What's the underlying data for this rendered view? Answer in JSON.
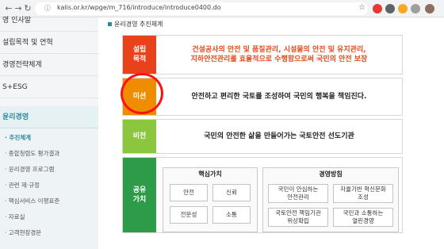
{
  "browser": {
    "back_icon": "arrow-left-icon",
    "forward_icon": "arrow-right-icon",
    "reload_icon": "reload-icon",
    "url": "kalis.or.kr/wpge/m_716/introduce/introduce0400.do"
  },
  "sidebar": {
    "items": [
      "영 인사말",
      "설립목적 및 연혁",
      "경영전략체계",
      "S+ESG"
    ],
    "active": "윤리경영",
    "sub_items": [
      "추진체계",
      "종합청렴도 평가결과",
      "윤리경영 프로그램",
      "관련 제·규정",
      "핵심서비스 이행표준",
      "자료실",
      "고객현장경문"
    ]
  },
  "main": {
    "heading": "윤리경영 추진체계",
    "rows": [
      {
        "tag": "설립\n목적",
        "color": "#e8421a",
        "text": "건설공사의 안전 및 품질관리, 시설물의 안전 및 유지관리,\n지하안전관리를 효율적으로 수행함으로써 국민의 안전 보장"
      },
      {
        "tag": "미션",
        "color": "#f08c00",
        "text": "안전하고 편리한 국토를 조성하여 국민의 행복을 책임진다."
      },
      {
        "tag": "비전",
        "color": "#8cc63f",
        "text": "국민의 안전한 삶을 만들어가는 국토안전 선도기관"
      },
      {
        "tag": "공유\n가치",
        "color": "#2e9b48",
        "text": ""
      }
    ],
    "core_values": {
      "title": "핵심가치",
      "items": [
        "안전",
        "신뢰",
        "전문성",
        "소통"
      ]
    },
    "management_policy": {
      "title": "경영방침",
      "items": [
        "국민이 안심하는\n안전관리",
        "자율기반 혁신문화\n조성",
        "국토안전 책임기관\n위상확립",
        "국민과 소통하는\n열린경영"
      ]
    }
  }
}
